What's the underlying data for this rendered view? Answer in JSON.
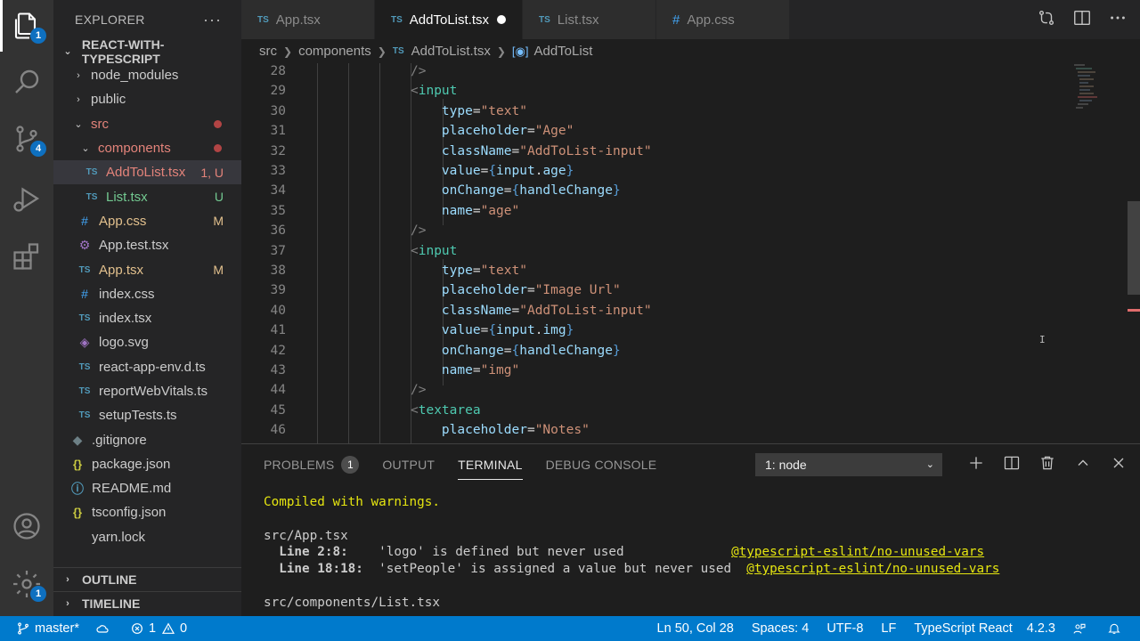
{
  "activity_bar": {
    "explorer_badge": "1",
    "scm_badge": "4",
    "settings_badge": "1"
  },
  "sidebar": {
    "title": "EXPLORER",
    "more": "···",
    "project": "REACT-WITH-TYPESCRIPT",
    "items": [
      {
        "label": "node_modules",
        "type": "folder",
        "open": false,
        "depth": 1
      },
      {
        "label": "public",
        "type": "folder",
        "open": false,
        "depth": 1
      },
      {
        "label": "src",
        "type": "folder",
        "open": true,
        "depth": 1
      },
      {
        "label": "components",
        "type": "folder",
        "open": true,
        "depth": 2
      },
      {
        "label": "AddToList.tsx",
        "type": "ts",
        "depth": 3,
        "status": "1, U"
      },
      {
        "label": "List.tsx",
        "type": "ts",
        "depth": 3,
        "status": "U"
      },
      {
        "label": "App.css",
        "type": "css",
        "depth": 2,
        "status": "M"
      },
      {
        "label": "App.test.tsx",
        "type": "test",
        "depth": 2
      },
      {
        "label": "App.tsx",
        "type": "ts",
        "depth": 2,
        "status": "M"
      },
      {
        "label": "index.css",
        "type": "css",
        "depth": 2
      },
      {
        "label": "index.tsx",
        "type": "ts",
        "depth": 2
      },
      {
        "label": "logo.svg",
        "type": "svg",
        "depth": 2
      },
      {
        "label": "react-app-env.d.ts",
        "type": "ts",
        "depth": 2
      },
      {
        "label": "reportWebVitals.ts",
        "type": "ts",
        "depth": 2
      },
      {
        "label": "setupTests.ts",
        "type": "ts",
        "depth": 2
      },
      {
        "label": ".gitignore",
        "type": "git",
        "depth": 1
      },
      {
        "label": "package.json",
        "type": "json",
        "depth": 1
      },
      {
        "label": "README.md",
        "type": "md",
        "depth": 1
      },
      {
        "label": "tsconfig.json",
        "type": "json",
        "depth": 1
      },
      {
        "label": "yarn.lock",
        "type": "lock",
        "depth": 1
      }
    ],
    "outline": "OUTLINE",
    "timeline": "TIMELINE"
  },
  "tabs": [
    {
      "label": "App.tsx",
      "icon": "TS"
    },
    {
      "label": "AddToList.tsx",
      "icon": "TS"
    },
    {
      "label": "List.tsx",
      "icon": "TS"
    },
    {
      "label": "App.css",
      "icon": "#"
    }
  ],
  "breadcrumb": {
    "parts": [
      "src",
      "components",
      "AddToList.tsx",
      "AddToList"
    ],
    "ts_icon": "TS"
  },
  "editor": {
    "line_numbers": [
      "28",
      "29",
      "30",
      "31",
      "32",
      "33",
      "34",
      "35",
      "36",
      "37",
      "38",
      "39",
      "40",
      "41",
      "42",
      "43",
      "44",
      "45",
      "46"
    ]
  },
  "panel": {
    "tabs": [
      "PROBLEMS",
      "OUTPUT",
      "TERMINAL",
      "DEBUG CONSOLE"
    ],
    "problems_count": "1",
    "terminal_select": "1: node",
    "terminal": {
      "line1": "Compiled with warnings.",
      "file1": "src/App.tsx",
      "w1_loc": "  Line 2:8:  ",
      "w1_msg": "  'logo' is defined but never used              ",
      "w1_rule": "@typescript-eslint/no-unused-vars",
      "w2_loc": "  Line 18:18:",
      "w2_msg": "  'setPeople' is assigned a value but never used  ",
      "w2_rule": "@typescript-eslint/no-unused-vars",
      "file2": "src/components/List.tsx"
    }
  },
  "statusbar": {
    "branch": "master*",
    "errors": "1",
    "warnings": "0",
    "position": "Ln 50, Col 28",
    "spaces": "Spaces: 4",
    "encoding": "UTF-8",
    "eol": "LF",
    "language": "TypeScript React",
    "version": "4.2.3"
  },
  "colors": {
    "accent": "#007acc",
    "badge": "#0e70c0"
  }
}
